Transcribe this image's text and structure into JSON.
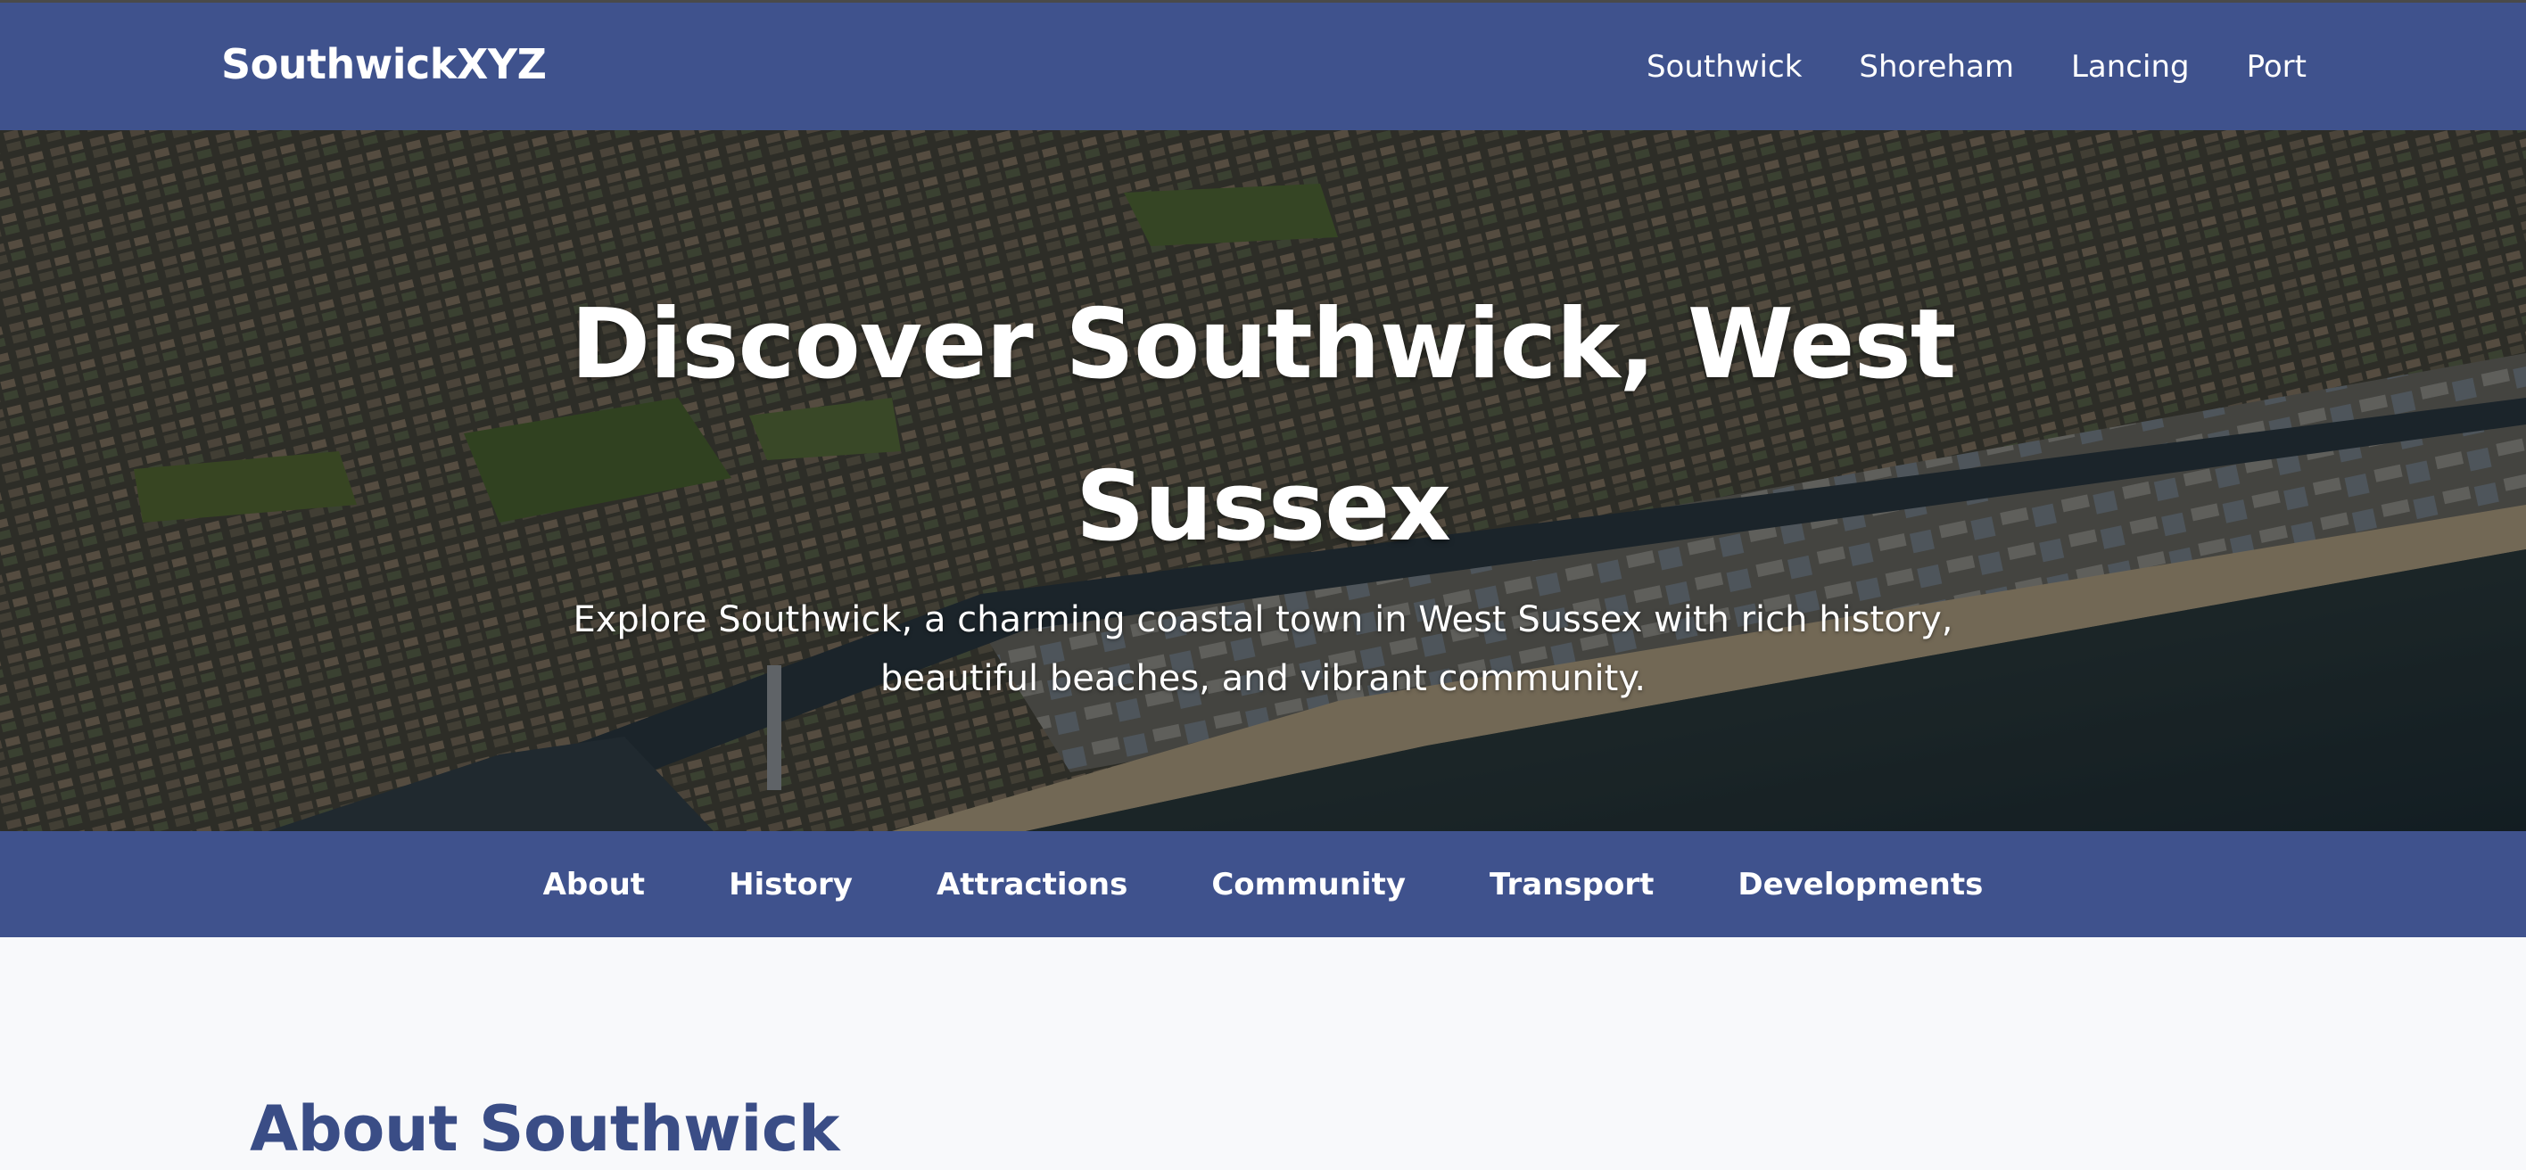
{
  "header": {
    "brand": "SouthwickXYZ",
    "nav": [
      "Southwick",
      "Shoreham",
      "Lancing",
      "Port"
    ]
  },
  "hero": {
    "title": "Discover Southwick, West Sussex",
    "subtitle": "Explore Southwick, a charming coastal town in West Sussex with rich history, beautiful beaches, and vibrant community."
  },
  "subnav": [
    "About",
    "History",
    "Attractions",
    "Community",
    "Transport",
    "Developments"
  ],
  "about": {
    "heading": "About Southwick"
  },
  "colors": {
    "brand_blue": "#3f528d",
    "heading_blue": "#3a4d86",
    "page_bg": "#f8f9fb"
  }
}
